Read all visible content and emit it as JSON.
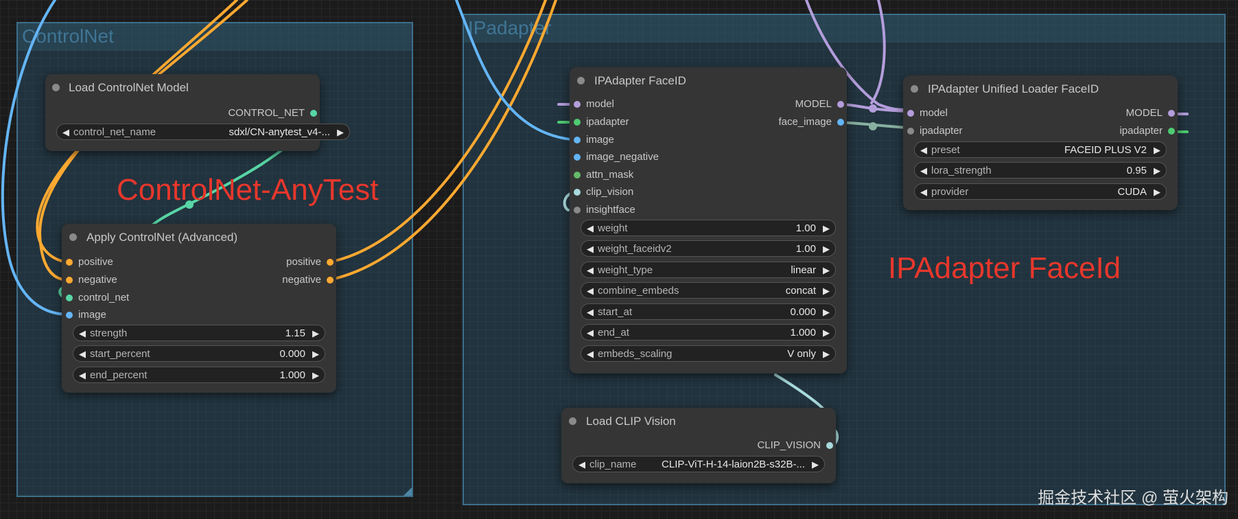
{
  "colors": {
    "model": "#b39ddb",
    "ipadapter": "#4ecb71",
    "image": "#64b5f6",
    "conditioning": "#ffa931",
    "control_net": "#58d6a5",
    "clip_vision": "#a8dadc",
    "generic": "#8a8a8a",
    "annotation": "#e8372c"
  },
  "groups": {
    "controlnet": {
      "title": "ControlNet"
    },
    "ipadapter": {
      "title": "IPadapter"
    }
  },
  "annotations": {
    "controlnet": "ControlNet-AnyTest",
    "ipadapter": "IPAdapter FaceId"
  },
  "watermark": "掘金技术社区 @ 萤火架构",
  "nodes": {
    "load_controlnet": {
      "title": "Load ControlNet Model",
      "outputs": [
        "CONTROL_NET"
      ],
      "widgets": [
        {
          "name": "control_net_name",
          "value": "sdxl/CN-anytest_v4-..."
        }
      ]
    },
    "apply_controlnet": {
      "title": "Apply ControlNet (Advanced)",
      "inputs": [
        "positive",
        "negative",
        "control_net",
        "image"
      ],
      "outputs": [
        "positive",
        "negative"
      ],
      "widgets": [
        {
          "name": "strength",
          "value": "1.15"
        },
        {
          "name": "start_percent",
          "value": "0.000"
        },
        {
          "name": "end_percent",
          "value": "1.000"
        }
      ]
    },
    "ipadapter_faceid": {
      "title": "IPAdapter FaceID",
      "inputs": [
        "model",
        "ipadapter",
        "image",
        "image_negative",
        "attn_mask",
        "clip_vision",
        "insightface"
      ],
      "outputs": [
        "MODEL",
        "face_image"
      ],
      "widgets": [
        {
          "name": "weight",
          "value": "1.00"
        },
        {
          "name": "weight_faceidv2",
          "value": "1.00"
        },
        {
          "name": "weight_type",
          "value": "linear"
        },
        {
          "name": "combine_embeds",
          "value": "concat"
        },
        {
          "name": "start_at",
          "value": "0.000"
        },
        {
          "name": "end_at",
          "value": "1.000"
        },
        {
          "name": "embeds_scaling",
          "value": "V only"
        }
      ]
    },
    "unified_loader": {
      "title": "IPAdapter Unified Loader FaceID",
      "inputs": [
        "model",
        "ipadapter"
      ],
      "outputs": [
        "MODEL",
        "ipadapter"
      ],
      "widgets": [
        {
          "name": "preset",
          "value": "FACEID PLUS V2"
        },
        {
          "name": "lora_strength",
          "value": "0.95"
        },
        {
          "name": "provider",
          "value": "CUDA"
        }
      ]
    },
    "load_clip_vision": {
      "title": "Load CLIP Vision",
      "outputs": [
        "CLIP_VISION"
      ],
      "widgets": [
        {
          "name": "clip_name",
          "value": "CLIP-ViT-H-14-laion2B-s32B-..."
        }
      ]
    }
  }
}
